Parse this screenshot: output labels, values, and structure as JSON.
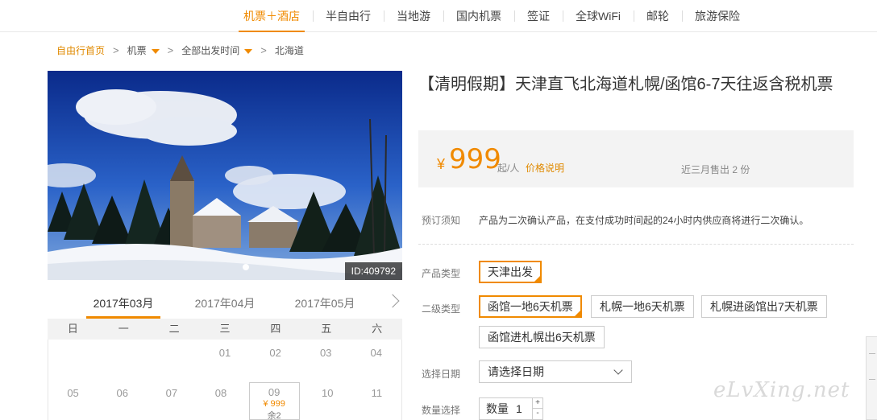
{
  "nav": {
    "items": [
      "机票＋酒店",
      "半自由行",
      "当地游",
      "国内机票",
      "签证",
      "全球WiFi",
      "邮轮",
      "旅游保险"
    ]
  },
  "breadcrumb": {
    "home": "自由行首页",
    "level1": "机票",
    "level2": "全部出发时间",
    "current": "北海道",
    "sep": ">"
  },
  "photo": {
    "id_label": "ID:409792",
    "alt": "snowy church landscape"
  },
  "calendar": {
    "months": [
      "2017年03月",
      "2017年04月",
      "2017年05月"
    ],
    "weekdays": [
      "日",
      "一",
      "二",
      "三",
      "四",
      "五",
      "六"
    ],
    "row1": [
      "",
      "",
      "",
      "01",
      "02",
      "03",
      "04"
    ],
    "row2": [
      "05",
      "06",
      "07",
      "08",
      "09",
      "10",
      "11"
    ],
    "featured_price": "¥ 999",
    "featured_remaining": "余2"
  },
  "product": {
    "title": "【清明假期】天津直飞北海道札幌/函馆6-7天往返含税机票",
    "currency": "¥",
    "price": "999",
    "price_unit": "起/人",
    "price_explain": "价格说明",
    "sold": "近三月售出 2 份",
    "notice_label": "预订须知",
    "notice_text": "产品为二次确认产品，在支付成功时间起的24小时内供应商将进行二次确认。"
  },
  "options": {
    "type_label": "产品类型",
    "type_value": "天津出发",
    "sub_label": "二级类型",
    "sub_values": [
      "函馆一地6天机票",
      "札幌一地6天机票",
      "札幌进函馆出7天机票",
      "函馆进札幌出6天机票"
    ],
    "date_label": "选择日期",
    "date_placeholder": "请选择日期",
    "qty_label": "数量选择",
    "qty_inner_label": "数量",
    "qty_value": "1",
    "qty_up": "+",
    "qty_down": "-"
  },
  "watermark": "eLvXing.net",
  "colors": {
    "accent": "#f08a00"
  }
}
